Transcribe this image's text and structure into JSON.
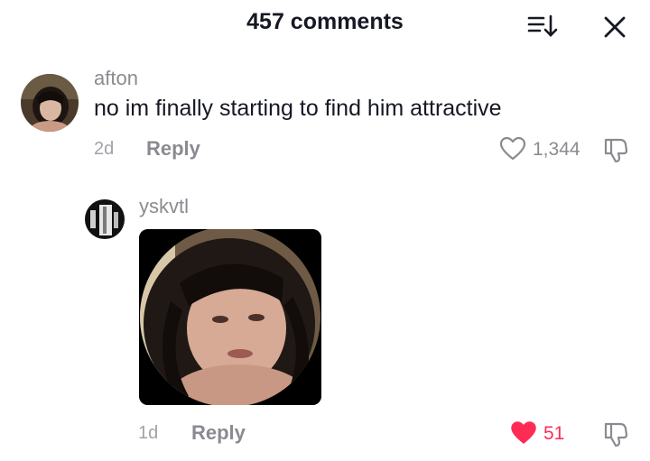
{
  "header": {
    "title": "457 comments",
    "sort_icon": "sort-icon",
    "close_icon": "close-icon"
  },
  "comment": {
    "username": "afton",
    "text": "no im finally starting to find him attractive",
    "time": "2d",
    "reply_label": "Reply",
    "like_count": "1,344",
    "liked": false
  },
  "reply": {
    "username": "yskvtl",
    "time": "1d",
    "reply_label": "Reply",
    "like_count": "51",
    "liked": true,
    "attachment": "photo-sticker"
  },
  "colors": {
    "text_primary": "#161823",
    "text_secondary": "#8a8b91",
    "like_active": "#fe2c55"
  }
}
